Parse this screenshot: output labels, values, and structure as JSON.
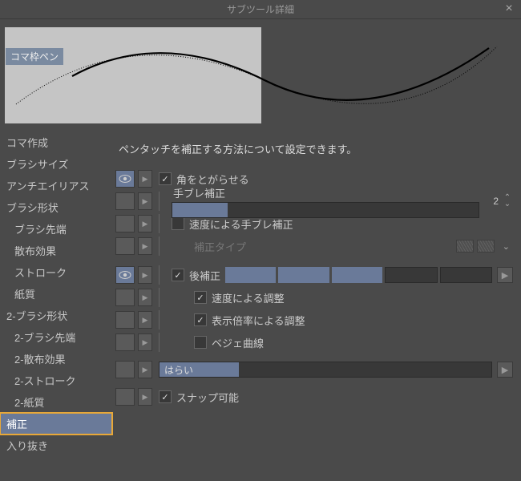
{
  "title": "サブツール詳細",
  "preview_label": "コマ枠ペン",
  "sidebar": {
    "items": [
      {
        "label": "コマ作成"
      },
      {
        "label": "ブラシサイズ"
      },
      {
        "label": "アンチエイリアス"
      },
      {
        "label": "ブラシ形状"
      },
      {
        "label": "ブラシ先端",
        "sub": true
      },
      {
        "label": "散布効果",
        "sub": true
      },
      {
        "label": "ストローク",
        "sub": true
      },
      {
        "label": "紙質",
        "sub": true
      },
      {
        "label": "2-ブラシ形状"
      },
      {
        "label": "2-ブラシ先端",
        "sub": true
      },
      {
        "label": "2-散布効果",
        "sub": true
      },
      {
        "label": "2-ストローク",
        "sub": true
      },
      {
        "label": "2-紙質",
        "sub": true
      },
      {
        "label": "補正",
        "selected": true
      },
      {
        "label": "入り抜き"
      }
    ]
  },
  "main": {
    "description": "ペンタッチを補正する方法について設定できます。",
    "rows": {
      "sharp_corners": {
        "checked": true,
        "label": "角をとがらせる"
      },
      "stabilize": {
        "label": "手ブレ補正",
        "value": "2",
        "fill_pct": 18
      },
      "speed_stabilize": {
        "checked": false,
        "label": "速度による手ブレ補正"
      },
      "correction_type": {
        "label": "補正タイプ"
      },
      "post_correct": {
        "checked": true,
        "label": "後補正",
        "segments": [
          1,
          1,
          1,
          0,
          0
        ]
      },
      "speed_adjust": {
        "checked": true,
        "label": "速度による調整"
      },
      "zoom_adjust": {
        "checked": true,
        "label": "表示倍率による調整"
      },
      "bezier": {
        "checked": false,
        "label": "ベジェ曲線"
      },
      "taper": {
        "label": "はらい",
        "fill_pct": 24
      },
      "snap": {
        "checked": true,
        "label": "スナップ可能"
      }
    }
  }
}
